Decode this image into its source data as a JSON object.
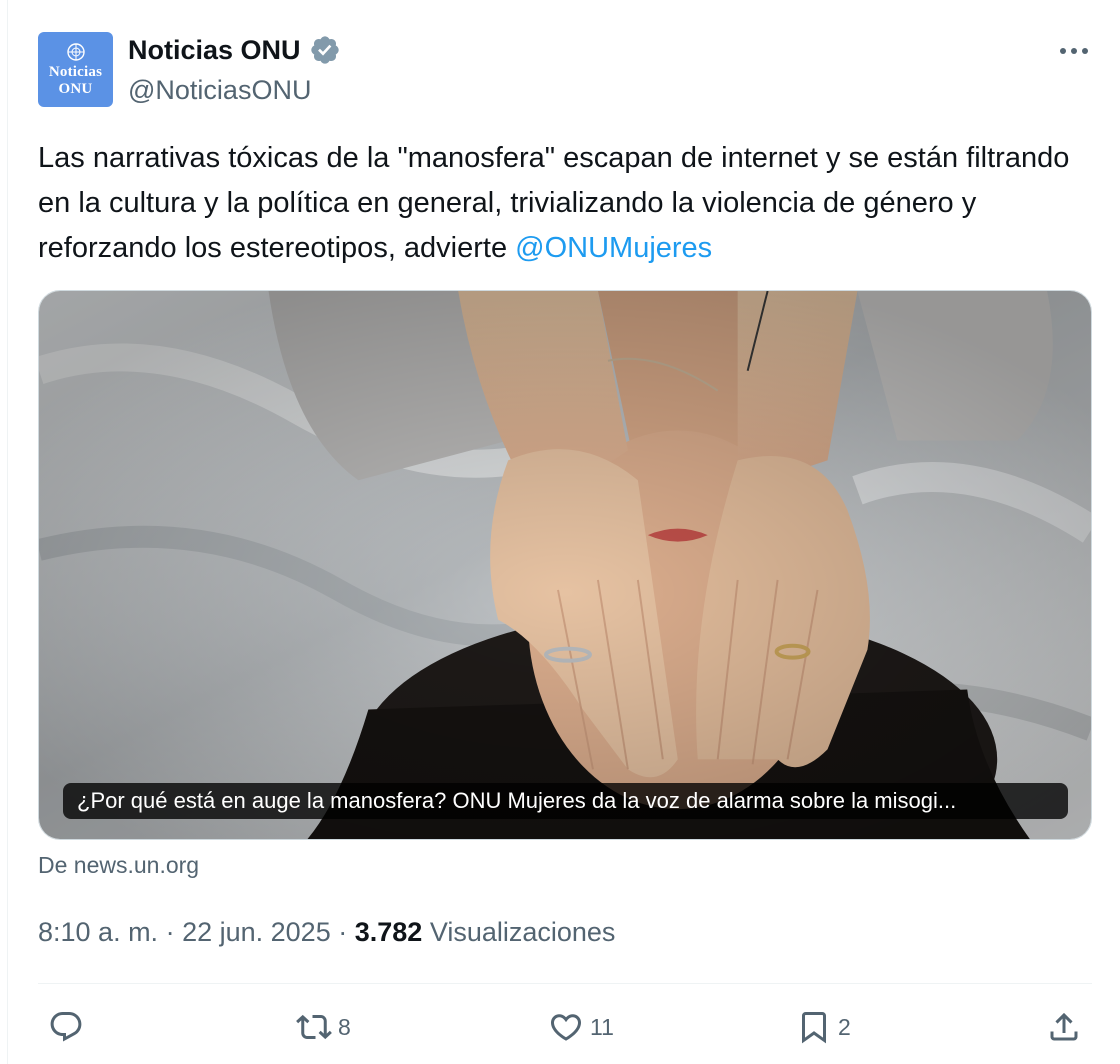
{
  "account": {
    "display_name": "Noticias ONU",
    "handle": "@NoticiasONU",
    "avatar_lines": [
      "Noticias",
      "ONU"
    ],
    "verified_color": "#829aab"
  },
  "post": {
    "text": "Las narrativas tóxicas de la \"manosfera\" escapan de internet y se están filtrando en la cultura y la política en general, trivializando la violencia de género y reforzando los estereotipos, advierte ",
    "mention": "@ONUMujeres"
  },
  "card": {
    "caption": "¿Por qué está en auge la manosfera? ONU Mujeres da la voz de alarma sobre la misogi...",
    "source": "De news.un.org"
  },
  "meta": {
    "time": "8:10 a. m.",
    "date": "22 jun. 2025",
    "views_count": "3.782",
    "views_label": "Visualizaciones"
  },
  "actions": {
    "reply_count": "",
    "retweet_count": "8",
    "like_count": "11",
    "bookmark_count": "2"
  },
  "colors": {
    "accent": "#1d9bf0",
    "secondary_text": "#536471",
    "avatar_bg": "#5b92e5"
  },
  "icons": [
    "more-icon",
    "verified-icon",
    "reply-icon",
    "retweet-icon",
    "like-icon",
    "bookmark-icon",
    "share-icon"
  ]
}
